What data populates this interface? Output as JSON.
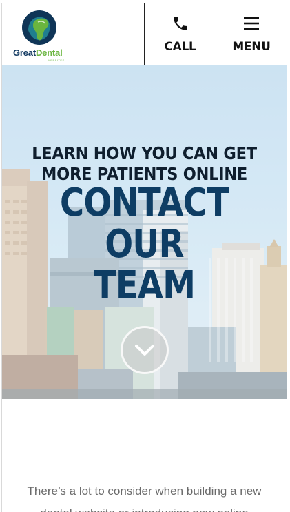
{
  "header": {
    "logo": {
      "word1": "Great",
      "word2": "Dental",
      "sub": "WEBSITES"
    },
    "call_label": "CALL",
    "menu_label": "MENU"
  },
  "hero": {
    "kicker_line1": "LEARN HOW YOU CAN GET",
    "kicker_line2": "MORE PATIENTS ONLINE",
    "title_line1": "CONTACT OUR",
    "title_line2": "TEAM"
  },
  "intro": {
    "line1": "There’s a lot to consider when building a new",
    "line2": "dental website or introducing new online"
  },
  "colors": {
    "brand_navy": "#0e3d64",
    "brand_green": "#6ab53f",
    "sky": "#b9d8ee",
    "body_text": "#6b6b6b"
  },
  "icons": {
    "call": "phone-icon",
    "menu": "hamburger-icon",
    "scroll": "chevron-down-icon"
  }
}
